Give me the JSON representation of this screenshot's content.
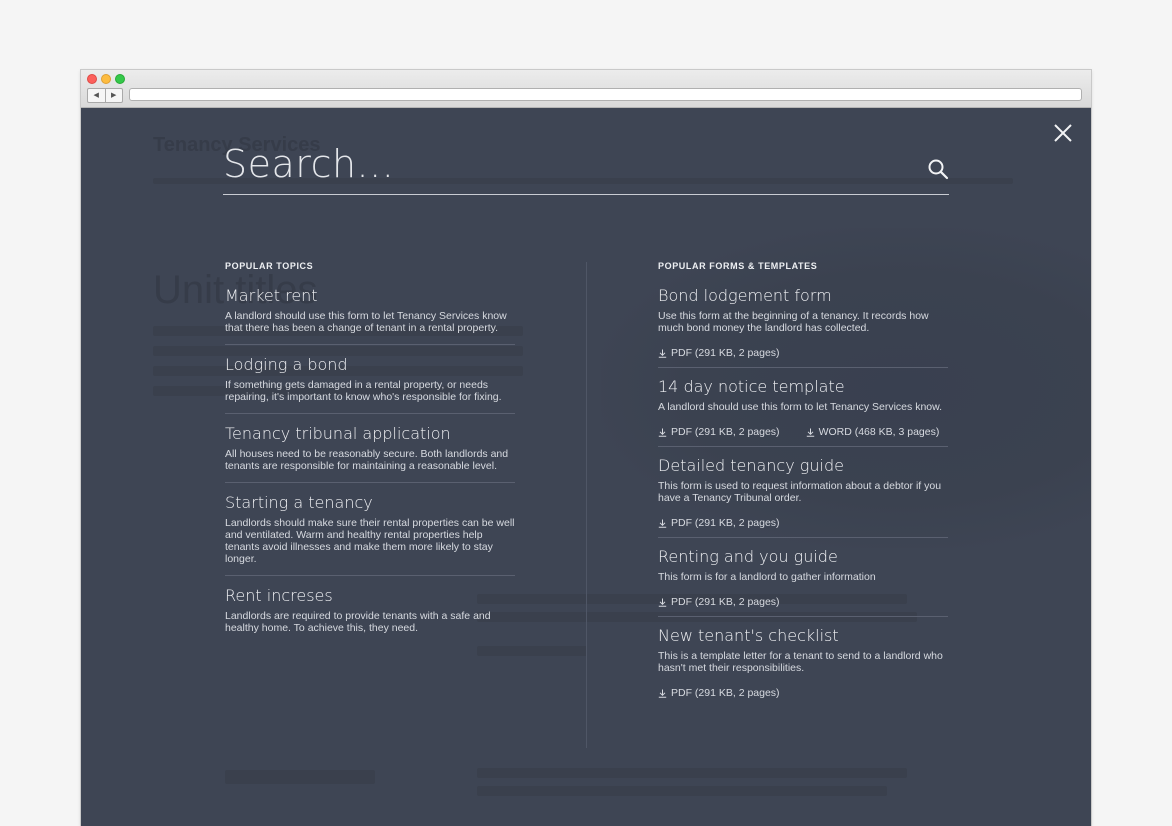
{
  "browser": {
    "back_label": "◀",
    "forward_label": "▶",
    "url": ""
  },
  "ghost_page": {
    "logo": "Tenancy Services",
    "title": "Unit titles"
  },
  "search": {
    "placeholder": "Search..."
  },
  "popular_topics": {
    "heading": "POPULAR TOPICS",
    "items": [
      {
        "title": "Market rent",
        "desc": "A landlord should use this form to let Tenancy Services know that there has been a change of tenant in a rental property."
      },
      {
        "title": "Lodging a bond",
        "desc": "If something gets damaged in a rental property, or needs repairing, it's important to know who's responsible for fixing."
      },
      {
        "title": "Tenancy tribunal application",
        "desc": "All houses need to be reasonably secure. Both landlords and tenants are responsible for maintaining a reasonable level."
      },
      {
        "title": "Starting a tenancy",
        "desc": "Landlords should make sure their rental properties can be well  and ventilated. Warm and healthy rental properties help tenants avoid illnesses and make them more likely to stay longer."
      },
      {
        "title": "Rent increses",
        "desc": "Landlords are required to provide tenants with a safe and healthy home. To achieve this, they need."
      }
    ]
  },
  "popular_forms": {
    "heading": "POPULAR FORMS & TEMPLATES",
    "items": [
      {
        "title": "Bond lodgement form",
        "desc": "Use this form at the beginning of a tenancy. It records how much bond money the landlord has collected.",
        "downloads": [
          "PDF (291 KB, 2 pages)"
        ]
      },
      {
        "title": "14 day notice template",
        "desc": "A landlord should use this form to let Tenancy Services know.",
        "downloads": [
          "PDF (291 KB, 2 pages)",
          "WORD (468 KB, 3 pages)"
        ]
      },
      {
        "title": "Detailed tenancy guide",
        "desc": "This form is used to request information about a debtor if you have a Tenancy Tribunal order.",
        "downloads": [
          "PDF (291 KB, 2 pages)"
        ]
      },
      {
        "title": "Renting and you guide",
        "desc": "This form is for a landlord to gather information",
        "downloads": [
          "PDF (291 KB, 2 pages)"
        ]
      },
      {
        "title": "New tenant's checklist",
        "desc": "This is a template letter for a tenant to send to a landlord who hasn't met their responsibilities.",
        "downloads": [
          "PDF (291 KB, 2 pages)"
        ]
      }
    ]
  },
  "icons": {
    "close": "close-icon",
    "search": "search-icon",
    "download": "download-icon"
  },
  "colors": {
    "overlay": "#3e4554",
    "text": "#f0f1f4",
    "muted": "#d7dae0"
  }
}
